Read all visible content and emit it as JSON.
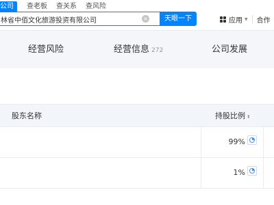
{
  "search": {
    "tabs": [
      {
        "label": "公司",
        "active": true
      },
      {
        "label": "查老板"
      },
      {
        "label": "查关系"
      },
      {
        "label": "查风险"
      }
    ],
    "value": "林省中佰文化旅游投资有限公司",
    "clear_icon": "×",
    "button_label": "天眼一下"
  },
  "header": {
    "apps_label": "应用",
    "coop_label": "合作"
  },
  "nav": {
    "items": [
      {
        "label": "经营风险"
      },
      {
        "label": "经营信息",
        "count": "272"
      },
      {
        "label": "公司发展"
      }
    ]
  },
  "table": {
    "headers": {
      "name": "股东名称",
      "ratio": "持股比例"
    },
    "rows": [
      {
        "ratio": "99%"
      },
      {
        "ratio": "1%"
      }
    ]
  },
  "colors": {
    "accent": "#0084ff",
    "header_bg": "#f2f5f9"
  }
}
